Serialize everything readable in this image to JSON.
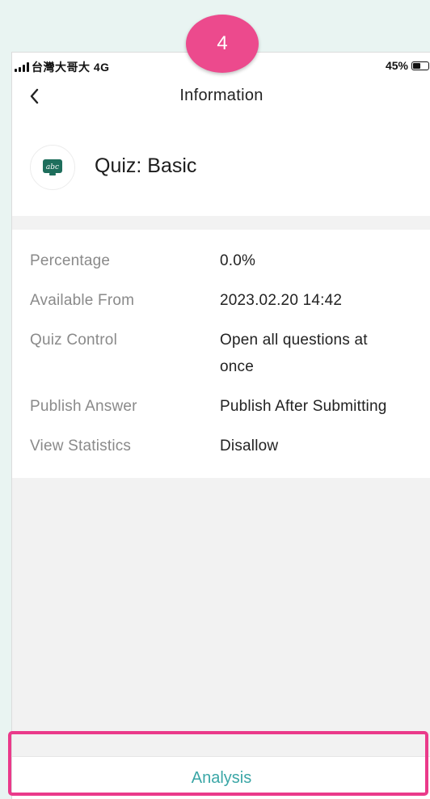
{
  "status_bar": {
    "carrier": "台灣大哥大 4G",
    "battery": "45%"
  },
  "header": {
    "title": "Information",
    "back_icon": "chevron-left-icon",
    "quiz_icon": "abc-board-icon",
    "quiz_title": "Quiz: Basic"
  },
  "info": {
    "rows": [
      {
        "label": "Percentage",
        "value": "0.0%"
      },
      {
        "label": "Available From",
        "value": "2023.02.20 14:42"
      },
      {
        "label": "Quiz Control",
        "value": "Open all questions at once"
      },
      {
        "label": "Publish Answer",
        "value": "Publish After Submitting"
      },
      {
        "label": "View Statistics",
        "value": "Disallow"
      }
    ]
  },
  "footer": {
    "analysis_label": "Analysis"
  },
  "overlay": {
    "step_number": "4",
    "highlight_color": "#ea3a8a"
  },
  "colors": {
    "accent": "#3aa6a6",
    "quiz_icon_green": "#1e6e5c",
    "background": "#e9f4f2"
  }
}
